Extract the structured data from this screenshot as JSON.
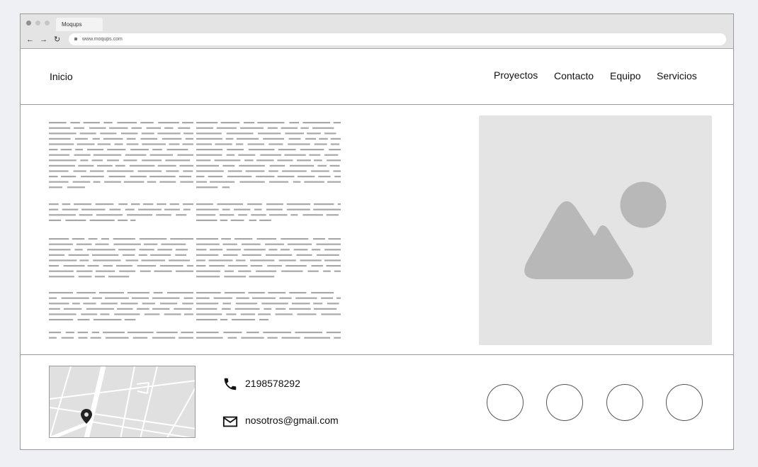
{
  "browser": {
    "tab_title": "Moqups",
    "url": "www.moqups.com",
    "back_icon": "←",
    "forward_icon": "→",
    "reload_icon": "↻"
  },
  "header": {
    "brand": "Inicio",
    "nav": [
      "Proyectos",
      "Contacto",
      "Equipo",
      "Servicios"
    ]
  },
  "footer": {
    "phone": "2198578292",
    "email": "nosotros@gmail.com"
  },
  "icons": {
    "image_placeholder": "mountain-image-icon",
    "phone": "phone-icon",
    "email": "mail-icon",
    "map_pin": "map-pin-icon"
  },
  "colors": {
    "placeholder_bg": "#e4e4e4",
    "placeholder_shape": "#b8b8b8",
    "text_line": "#a8a8a8",
    "border": "#9a9a9a"
  }
}
